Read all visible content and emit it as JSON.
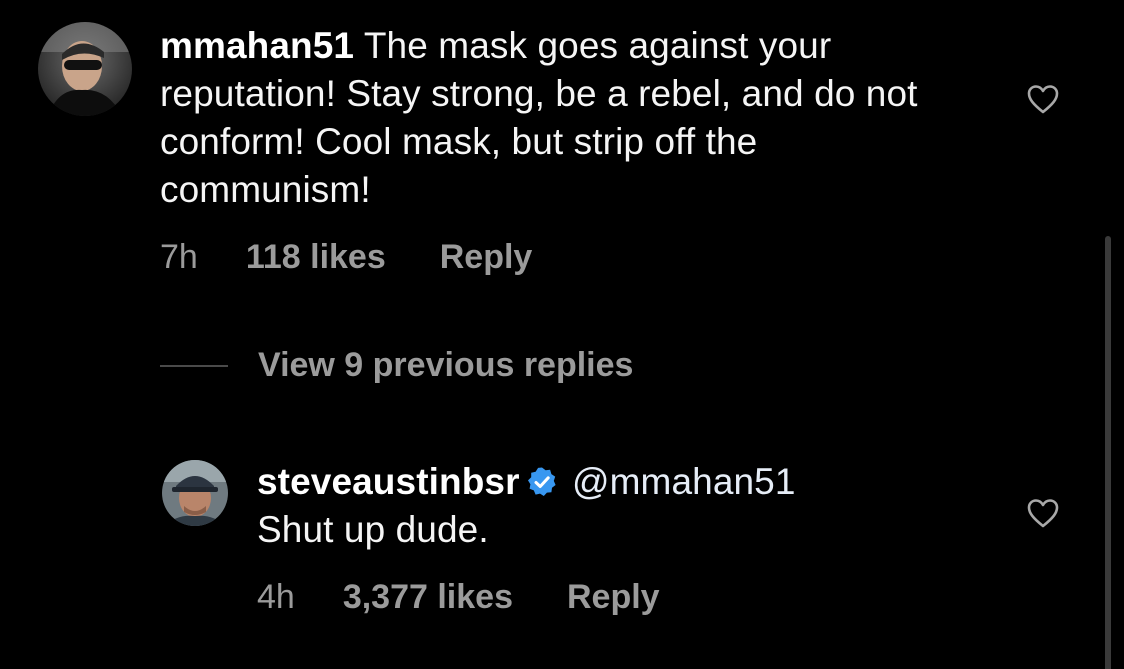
{
  "comments": [
    {
      "username": "mmahan51",
      "text": "The mask goes against your reputation!  Stay strong, be a rebel, and do not conform!  Cool mask, but strip off the communism!",
      "time": "7h",
      "likes": "118 likes",
      "reply_label": "Reply",
      "avatar_icon": "profile-photo-sunglasses"
    },
    {
      "username": "steveaustinbsr",
      "verified": true,
      "mention": "@mmahan51",
      "text": "Shut up dude.",
      "time": "4h",
      "likes": "3,377 likes",
      "reply_label": "Reply",
      "avatar_icon": "profile-photo-cap"
    }
  ],
  "view_replies_label": "View 9 previous replies",
  "colors": {
    "background": "#000000",
    "text": "#ffffff",
    "secondary_text": "#9b9b9b",
    "verified_badge": "#3897f0"
  }
}
